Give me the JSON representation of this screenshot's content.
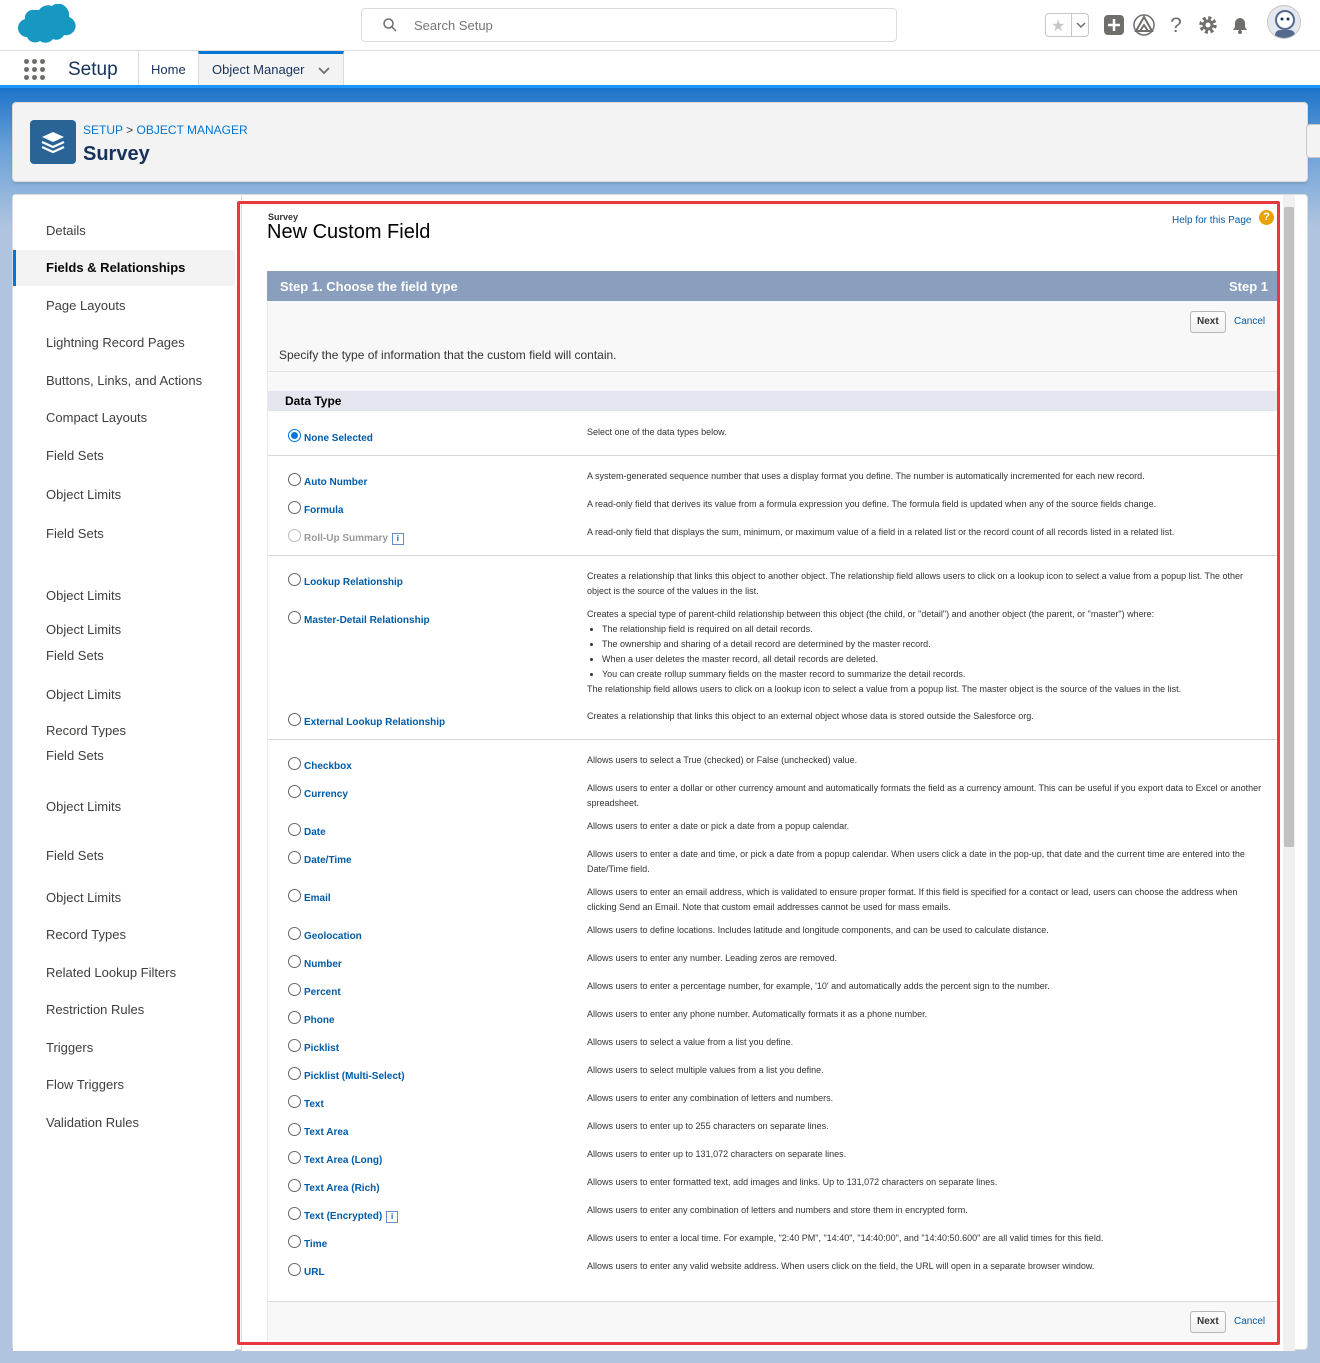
{
  "header": {
    "search_placeholder": "Search Setup",
    "icons": [
      "salesforce-cloud-logo",
      "search-icon",
      "star-icon",
      "chevron-down-icon",
      "add-icon",
      "trailhead-icon",
      "help-icon",
      "gear-icon",
      "bell-icon",
      "avatar"
    ]
  },
  "nav": {
    "app_name": "Setup",
    "tabs": [
      {
        "label": "Home"
      },
      {
        "label": "Object Manager"
      }
    ]
  },
  "page_header": {
    "breadcrumb_setup": "SETUP",
    "breadcrumb_sep": ">",
    "breadcrumb_om": "OBJECT MANAGER",
    "title": "Survey"
  },
  "sidebar": {
    "items": [
      {
        "label": "Details"
      },
      {
        "label": "Fields & Relationships",
        "active": true
      },
      {
        "label": "Page Layouts"
      },
      {
        "label": "Lightning Record Pages"
      },
      {
        "label": "Buttons, Links, and Actions"
      },
      {
        "label": "Compact Layouts"
      },
      {
        "label": "Field Sets"
      },
      {
        "label": "Object Limits"
      },
      {
        "label": "Field Sets"
      },
      {
        "label": "Object Limits"
      },
      {
        "label": "Object Limits"
      },
      {
        "label": "Field Sets"
      },
      {
        "label": "Object Limits"
      },
      {
        "label": "Record Types"
      },
      {
        "label": "Field Sets"
      },
      {
        "label": "Object Limits"
      },
      {
        "label": "Field Sets"
      },
      {
        "label": "Object Limits"
      },
      {
        "label": "Record Types"
      },
      {
        "label": "Related Lookup Filters"
      },
      {
        "label": "Restriction Rules"
      },
      {
        "label": "Triggers"
      },
      {
        "label": "Flow Triggers"
      },
      {
        "label": "Validation Rules"
      }
    ]
  },
  "content": {
    "object_label": "Survey",
    "page_title": "New Custom Field",
    "help_link": "Help for this Page",
    "help_icon": "?",
    "step_title": "Step 1. Choose the field type",
    "step_label": "Step 1",
    "next_label": "Next",
    "cancel_label": "Cancel",
    "intro": "Specify the type of information that the custom field will contain.",
    "data_type_header": "Data Type",
    "info_glyph": "i",
    "types": [
      {
        "label": "None Selected",
        "desc": "Select one of the data types below.",
        "checked": true
      },
      {
        "label": "Auto Number",
        "desc": "A system-generated sequence number that uses a display format you define. The number is automatically incremented for each new record."
      },
      {
        "label": "Formula",
        "desc": "A read-only field that derives its value from a formula expression you define. The formula field is updated when any of the source fields change."
      },
      {
        "label": "Roll-Up Summary",
        "desc": "A read-only field that displays the sum, minimum, or maximum value of a field in a related list or the record count of all records listed in a related list.",
        "disabled": true
      },
      {
        "label": "Lookup Relationship",
        "desc": "Creates a relationship that links this object to another object. The relationship field allows users to click on a lookup icon to select a value from a popup list. The other object is the source of the values in the list."
      },
      {
        "label": "Master-Detail Relationship",
        "desc": "Creates a special type of parent-child relationship between this object (the child, or \"detail\") and another object (the parent, or \"master\") where:",
        "bullets": [
          "The relationship field is required on all detail records.",
          "The ownership and sharing of a detail record are determined by the master record.",
          "When a user deletes the master record, all detail records are deleted.",
          "You can create rollup summary fields on the master record to summarize the detail records."
        ],
        "desc_after": "The relationship field allows users to click on a lookup icon to select a value from a popup list. The master object is the source of the values in the list."
      },
      {
        "label": "External Lookup Relationship",
        "desc": "Creates a relationship that links this object to an external object whose data is stored outside the Salesforce org."
      },
      {
        "label": "Checkbox",
        "desc": "Allows users to select a True (checked) or False (unchecked) value."
      },
      {
        "label": "Currency",
        "desc": "Allows users to enter a dollar or other currency amount and automatically formats the field as a currency amount. This can be useful if you export data to Excel or another spreadsheet."
      },
      {
        "label": "Date",
        "desc": "Allows users to enter a date or pick a date from a popup calendar."
      },
      {
        "label": "Date/Time",
        "desc": "Allows users to enter a date and time, or pick a date from a popup calendar. When users click a date in the pop-up, that date and the current time are entered into the Date/Time field."
      },
      {
        "label": "Email",
        "desc": "Allows users to enter an email address, which is validated to ensure proper format. If this field is specified for a contact or lead, users can choose the address when clicking Send an Email. Note that custom email addresses cannot be used for mass emails."
      },
      {
        "label": "Geolocation",
        "desc": "Allows users to define locations. Includes latitude and longitude components, and can be used to calculate distance."
      },
      {
        "label": "Number",
        "desc": "Allows users to enter any number. Leading zeros are removed."
      },
      {
        "label": "Percent",
        "desc": "Allows users to enter a percentage number, for example, '10' and automatically adds the percent sign to the number."
      },
      {
        "label": "Phone",
        "desc": "Allows users to enter any phone number. Automatically formats it as a phone number."
      },
      {
        "label": "Picklist",
        "desc": "Allows users to select a value from a list you define."
      },
      {
        "label": "Picklist (Multi-Select)",
        "desc": "Allows users to select multiple values from a list you define."
      },
      {
        "label": "Text",
        "desc": "Allows users to enter any combination of letters and numbers."
      },
      {
        "label": "Text Area",
        "desc": "Allows users to enter up to 255 characters on separate lines."
      },
      {
        "label": "Text Area (Long)",
        "desc": "Allows users to enter up to 131,072 characters on separate lines."
      },
      {
        "label": "Text Area (Rich)",
        "desc": "Allows users to enter formatted text, add images and links. Up to 131,072 characters on separate lines."
      },
      {
        "label": "Text (Encrypted)",
        "desc": "Allows users to enter any combination of letters and numbers and store them in encrypted form."
      },
      {
        "label": "Time",
        "desc": "Allows users to enter a local time. For example, \"2:40 PM\", \"14:40\", \"14:40:00\", and \"14:40:50.600\" are all valid times for this field."
      },
      {
        "label": "URL",
        "desc": "Allows users to enter any valid website address. When users click on the field, the URL will open in a separate browser window."
      }
    ]
  },
  "colors": {
    "brand": "#0176d3",
    "link": "#015ba7",
    "step_header": "#8a9ebe",
    "highlight_box": "#e8383f"
  }
}
